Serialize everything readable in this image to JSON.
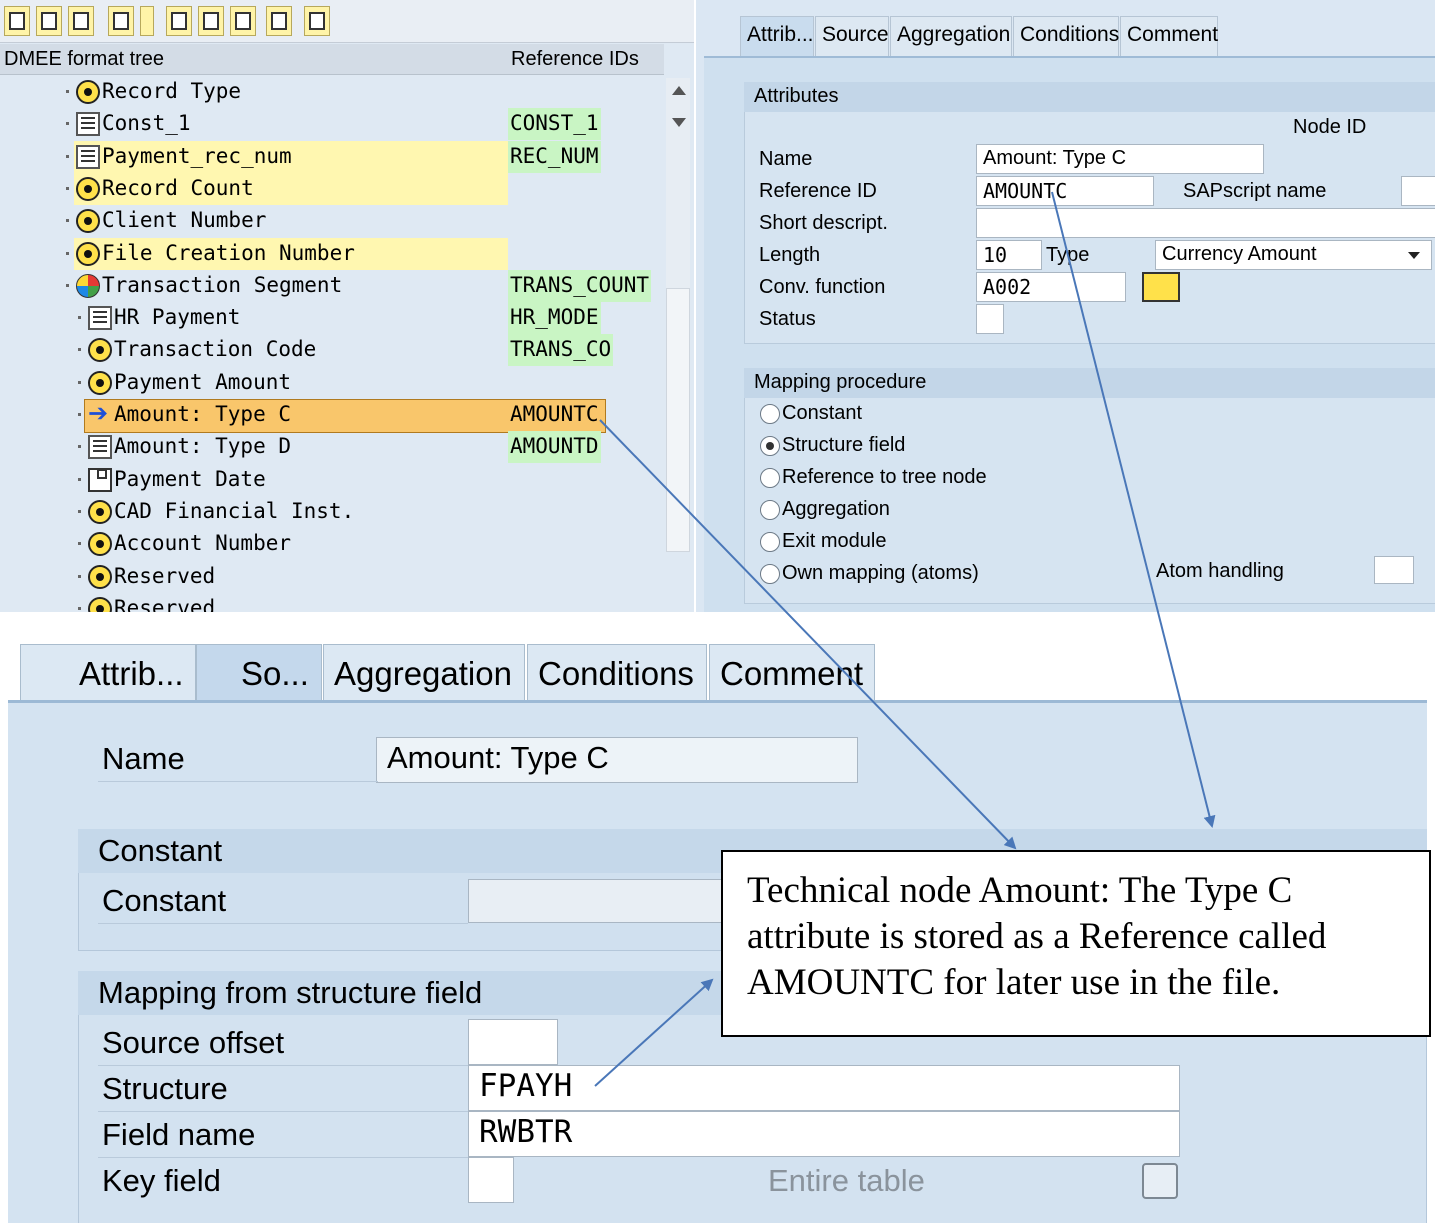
{
  "toolbar": {
    "icons": [
      "expand-icon",
      "collapse-icon",
      "save-icon",
      "new-icon",
      "cut-icon",
      "copy-icon",
      "paste-icon",
      "delete-icon",
      "find-icon"
    ]
  },
  "tree": {
    "col_tree": "DMEE format tree",
    "col_ref": "Reference IDs",
    "rows": [
      {
        "label": "Record Type",
        "ref": "",
        "icon": "element-icon",
        "highlight": false
      },
      {
        "label": "Const_1",
        "ref": "CONST_1",
        "icon": "technical-node-icon",
        "highlight": false
      },
      {
        "label": "Payment_rec_num",
        "ref": "REC_NUM",
        "icon": "technical-node-icon",
        "highlight": true
      },
      {
        "label": "Record Count",
        "ref": "",
        "icon": "element-icon",
        "highlight": true
      },
      {
        "label": "Client Number",
        "ref": "",
        "icon": "element-icon",
        "highlight": false
      },
      {
        "label": "File Creation Number",
        "ref": "",
        "icon": "element-icon",
        "highlight": true
      },
      {
        "label": "Transaction Segment",
        "ref": "TRANS_COUNT",
        "icon": "segment-icon",
        "highlight": false
      },
      {
        "label": "HR Payment",
        "ref": "HR_MODE",
        "icon": "technical-node-icon",
        "highlight": false
      },
      {
        "label": "Transaction Code",
        "ref": "TRANS_CO",
        "icon": "element-icon",
        "highlight": false
      },
      {
        "label": "Payment Amount",
        "ref": "",
        "icon": "element-icon",
        "highlight": false
      },
      {
        "label": "Amount: Type C",
        "ref": "AMOUNTC",
        "icon": "arrow-right-icon",
        "highlight": false,
        "selected": true
      },
      {
        "label": "Amount: Type D",
        "ref": "AMOUNTD",
        "icon": "technical-node-icon",
        "highlight": false
      },
      {
        "label": "Payment Date",
        "ref": "",
        "icon": "atom-group-icon",
        "highlight": false
      },
      {
        "label": "CAD Financial Inst.",
        "ref": "",
        "icon": "element-icon",
        "highlight": false
      },
      {
        "label": "Account Number",
        "ref": "",
        "icon": "element-icon",
        "highlight": false
      },
      {
        "label": "Reserved",
        "ref": "",
        "icon": "element-icon",
        "highlight": false
      },
      {
        "label": "Reserved",
        "ref": "",
        "icon": "element-icon",
        "highlight": false
      }
    ]
  },
  "attr_tabs": [
    "Attrib...",
    "Source",
    "Aggregation",
    "Conditions",
    "Comment"
  ],
  "attributes": {
    "group_title": "Attributes",
    "node_id_label": "Node ID",
    "name_label": "Name",
    "name_value": "Amount: Type C",
    "refid_label": "Reference ID",
    "refid_value": "AMOUNTC",
    "sapscript_label": "SAPscript name",
    "short_label": "Short descript.",
    "short_value": "",
    "length_label": "Length",
    "length_value": "10",
    "type_label": "Type",
    "type_value": "Currency Amount",
    "conv_label": "Conv. function",
    "conv_value": "A002",
    "status_label": "Status"
  },
  "mapping": {
    "group_title": "Mapping procedure",
    "options": [
      {
        "label": "Constant",
        "selected": false
      },
      {
        "label": "Structure field",
        "selected": true
      },
      {
        "label": "Reference to tree node",
        "selected": false
      },
      {
        "label": "Aggregation",
        "selected": false
      },
      {
        "label": "Exit module",
        "selected": false
      },
      {
        "label": "Own mapping (atoms)",
        "selected": false
      }
    ],
    "atom_handling_label": "Atom handling"
  },
  "source_tabs": [
    "Attrib...",
    "So...",
    "Aggregation",
    "Conditions",
    "Comment"
  ],
  "source": {
    "name_label": "Name",
    "name_value": "Amount: Type C",
    "constant_group": "Constant",
    "constant_label": "Constant",
    "mapping_group": "Mapping from structure field",
    "offset_label": "Source offset",
    "structure_label": "Structure",
    "structure_value": "FPAYH",
    "field_label": "Field name",
    "field_value": "RWBTR",
    "key_label": "Key field",
    "entire_label": "Entire table"
  },
  "callout": {
    "text": "Technical node Amount: The Type C attribute is stored as a Reference called AMOUNTC for later use in the file."
  },
  "colors": {
    "arrow": "#4a77b8",
    "ref_highlight": "#c9f5c4",
    "row_highlight": "#fff7b0",
    "selected_row": "#f9c66b"
  }
}
